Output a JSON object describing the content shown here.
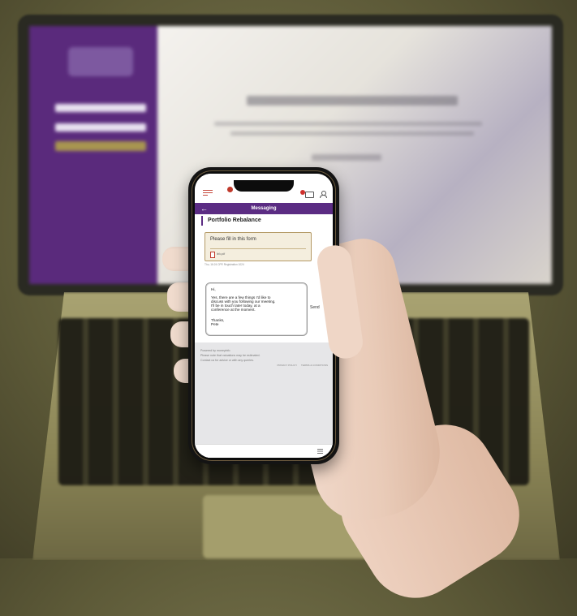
{
  "app": {
    "header_title": "Messaging",
    "mail_badge_count": ""
  },
  "thread": {
    "subject": "Portfolio Rebalance",
    "message_text": "Please fill in this form",
    "attachment_name": "link.pdf",
    "message_meta": "Thu, 16:24 CPR Registration 1024"
  },
  "compose": {
    "lines": [
      "Hi,",
      "Yes, there are a few things I'd like to",
      "discuss with you following our meeting.",
      "I'll be in touch later today, at a",
      "conference at the moment.",
      "",
      "Thanks,",
      "Pete"
    ],
    "send_label": "Send"
  },
  "footer": {
    "powered_by": "Powered by moneyinfo",
    "note_1": "Please note that valuations may be estimated.",
    "note_2": "Contact us for advice or with any queries.",
    "links": [
      "PRIVACY POLICY",
      "TERMS & CONDITIONS"
    ]
  },
  "colors": {
    "brand_purple": "#5b2c83",
    "accent_red": "#c0392b",
    "card_border": "#b49a66"
  },
  "icons": [
    "back-arrow-icon",
    "mail-icon",
    "user-icon",
    "pdf-icon",
    "menu-icon"
  ]
}
